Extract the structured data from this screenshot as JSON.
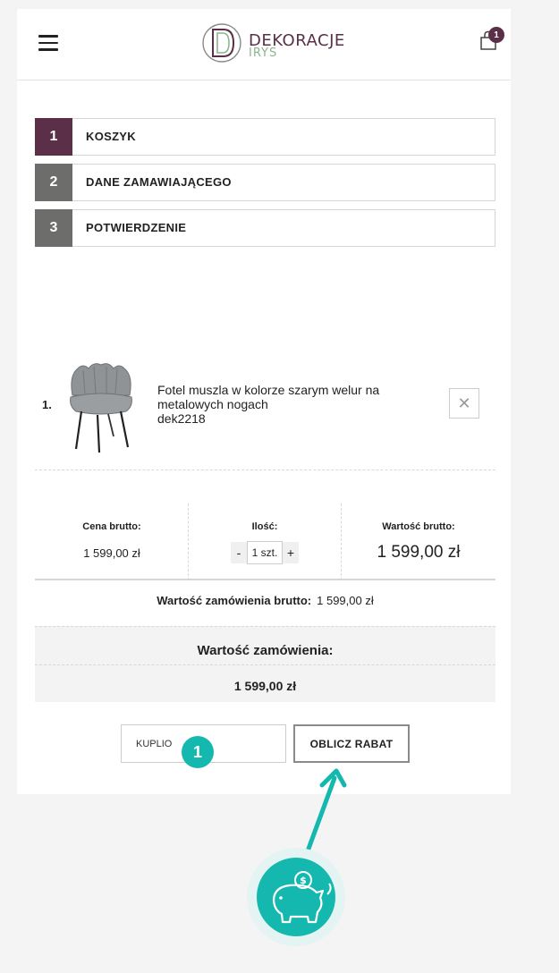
{
  "header": {
    "logo_top": "DEKORACJE",
    "logo_bottom": "IRYS",
    "cart_count": "1"
  },
  "steps": [
    {
      "number": "1",
      "label": "KOSZYK",
      "color": "#5b2f47"
    },
    {
      "number": "2",
      "label": "DANE ZAMAWIAJĄCEGO",
      "color": "#6d6d6b"
    },
    {
      "number": "3",
      "label": "POTWIERDZENIE",
      "color": "#6d6d6b"
    }
  ],
  "product": {
    "index": "1.",
    "name_line1": "Fotel muszla w kolorze szarym welur na",
    "name_line2": "metalowych nogach",
    "sku": "dek2218",
    "remove_icon": "close-icon"
  },
  "pricing": {
    "unit_label": "Cena brutto:",
    "unit_value": "1 599,00 zł",
    "qty_label": "Ilość:",
    "qty_minus": "-",
    "qty_value": "1 szt.",
    "qty_plus": "+",
    "total_label": "Wartość brutto:",
    "total_value": "1 599,00 zł"
  },
  "order": {
    "brutto_label": "Wartość zamówienia brutto:",
    "brutto_value": "1 599,00 zł",
    "summary_title": "Wartość zamówienia:",
    "summary_value": "1 599,00 zł"
  },
  "coupon": {
    "input_value": "KUPLIO",
    "button_label": "OBLICZ RABAT",
    "marker": "1"
  },
  "colors": {
    "brand": "#5b2f47",
    "accent": "#14b8ae"
  }
}
